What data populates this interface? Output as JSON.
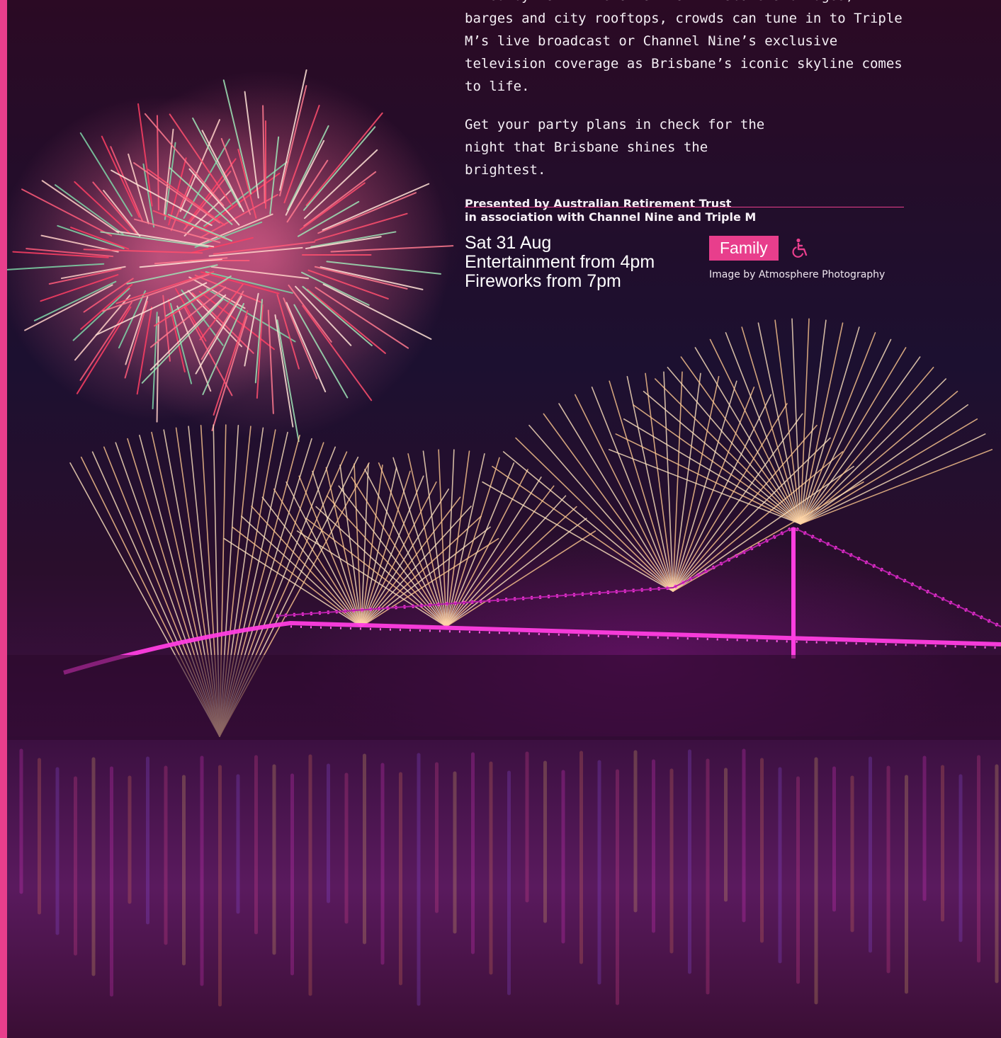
{
  "colors": {
    "accent": "#e83e8c",
    "text": "#ffffff"
  },
  "event": {
    "intro_partial": "Fired by Foti Fireworks from Brisbane’s bridges, barges",
    "paragraph1_rest": "and city rooftops, crowds can tune in to Triple M’s live broadcast or Channel Nine’s exclusive television coverage as Brisbane’s iconic skyline comes to life.",
    "paragraph2": "Get your party plans in check for the night that Brisbane shines the brightest.",
    "presented_line1": "Presented by Australian Retirement Trust",
    "presented_line2": "in association with Channel Nine and Triple M",
    "date": "Sat 31 Aug",
    "entertainment": "Entertainment from 4pm",
    "fireworks": "Fireworks from 7pm",
    "tag": "Family",
    "accessibility_icon": "wheelchair-accessible-icon",
    "image_credit": "Image by Atmosphere Photography"
  }
}
